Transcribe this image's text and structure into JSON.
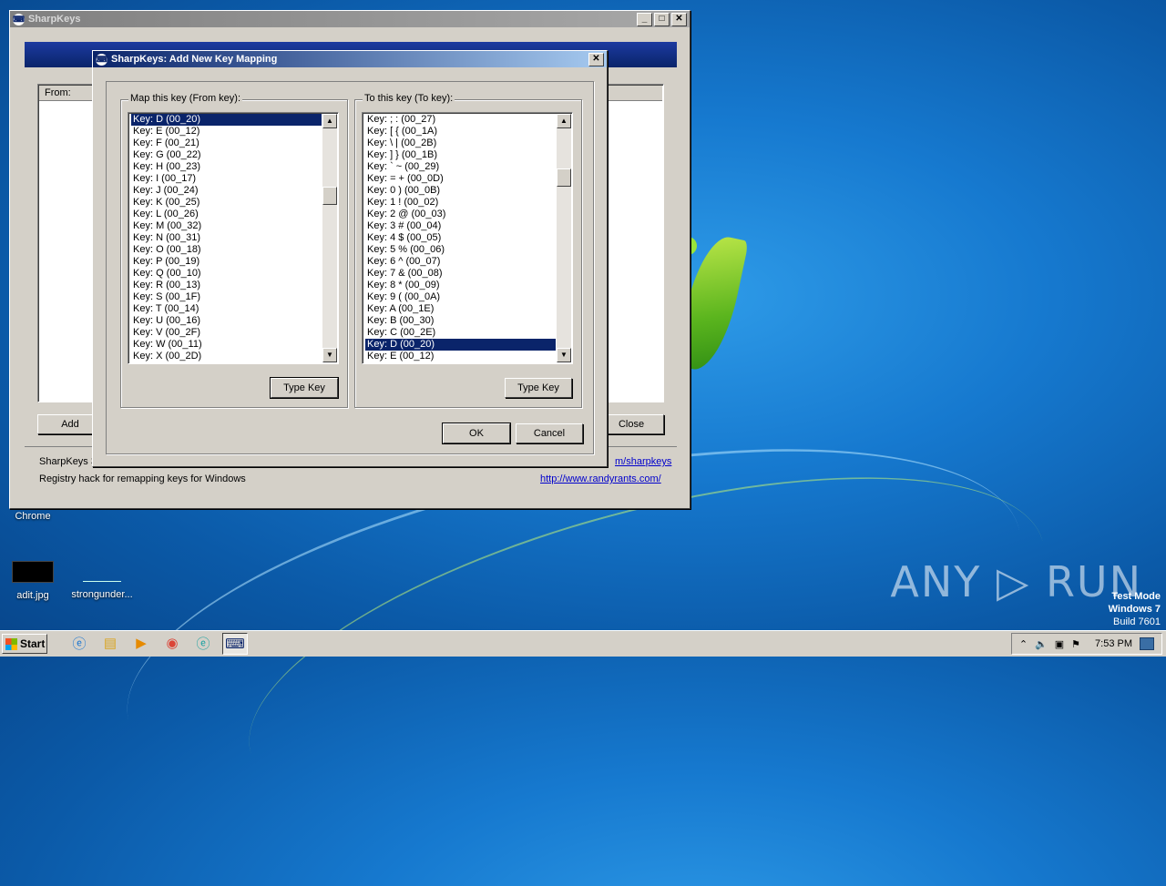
{
  "desktop": {
    "icons": [
      {
        "label": "Chrome"
      },
      {
        "label": "adit.jpg"
      },
      {
        "label": "strongunder..."
      }
    ],
    "watermark": "ANY ▷ RUN",
    "test_mode": {
      "line1": "Test Mode",
      "line2": "Windows 7",
      "line3": "Build 7601"
    }
  },
  "main_window": {
    "title": "SharpKeys",
    "list_header_from": "From:",
    "add_button": "Add",
    "close_button": "Close",
    "footer_line1": "SharpKeys 3",
    "footer_line2": "Registry hack for remapping keys for Windows",
    "link1": "m/sharpkeys",
    "link2": "http://www.randyrants.com/"
  },
  "dialog": {
    "title": "SharpKeys: Add New Key Mapping",
    "from_group_label": "Map this key (From key):",
    "to_group_label": "To this key (To key):",
    "type_key_button": "Type Key",
    "ok_button": "OK",
    "cancel_button": "Cancel",
    "from_items": [
      {
        "label": "Key: D (00_20)",
        "selected": true
      },
      {
        "label": "Key: E (00_12)"
      },
      {
        "label": "Key: F (00_21)"
      },
      {
        "label": "Key: G (00_22)"
      },
      {
        "label": "Key: H (00_23)"
      },
      {
        "label": "Key: I (00_17)"
      },
      {
        "label": "Key: J (00_24)"
      },
      {
        "label": "Key: K (00_25)"
      },
      {
        "label": "Key: L (00_26)"
      },
      {
        "label": "Key: M (00_32)"
      },
      {
        "label": "Key: N (00_31)"
      },
      {
        "label": "Key: O (00_18)"
      },
      {
        "label": "Key: P (00_19)"
      },
      {
        "label": "Key: Q (00_10)"
      },
      {
        "label": "Key: R (00_13)"
      },
      {
        "label": "Key: S (00_1F)"
      },
      {
        "label": "Key: T (00_14)"
      },
      {
        "label": "Key: U (00_16)"
      },
      {
        "label": "Key: V (00_2F)"
      },
      {
        "label": "Key: W (00_11)"
      },
      {
        "label": "Key: X (00_2D)"
      }
    ],
    "to_items": [
      {
        "label": "Key: ; : (00_27)"
      },
      {
        "label": "Key: [ { (00_1A)"
      },
      {
        "label": "Key: \\ | (00_2B)"
      },
      {
        "label": "Key: ] } (00_1B)"
      },
      {
        "label": "Key: ` ~ (00_29)"
      },
      {
        "label": "Key: = + (00_0D)"
      },
      {
        "label": "Key: 0 ) (00_0B)"
      },
      {
        "label": "Key: 1 ! (00_02)"
      },
      {
        "label": "Key: 2 @ (00_03)"
      },
      {
        "label": "Key: 3 # (00_04)"
      },
      {
        "label": "Key: 4 $ (00_05)"
      },
      {
        "label": "Key: 5 % (00_06)"
      },
      {
        "label": "Key: 6 ^ (00_07)"
      },
      {
        "label": "Key: 7 & (00_08)"
      },
      {
        "label": "Key: 8 * (00_09)"
      },
      {
        "label": "Key: 9 ( (00_0A)"
      },
      {
        "label": "Key: A (00_1E)"
      },
      {
        "label": "Key: B (00_30)"
      },
      {
        "label": "Key: C (00_2E)"
      },
      {
        "label": "Key: D (00_20)",
        "selected": true
      },
      {
        "label": "Key: E (00_12)"
      }
    ]
  },
  "taskbar": {
    "start_label": "Start",
    "apps": [
      {
        "icon": "ie-icon"
      },
      {
        "icon": "folder-icon"
      },
      {
        "icon": "media-player-icon"
      },
      {
        "icon": "chrome-icon"
      },
      {
        "icon": "edge-icon"
      },
      {
        "icon": "sharpkeys-icon",
        "active": true
      }
    ],
    "clock": "7:53 PM"
  }
}
